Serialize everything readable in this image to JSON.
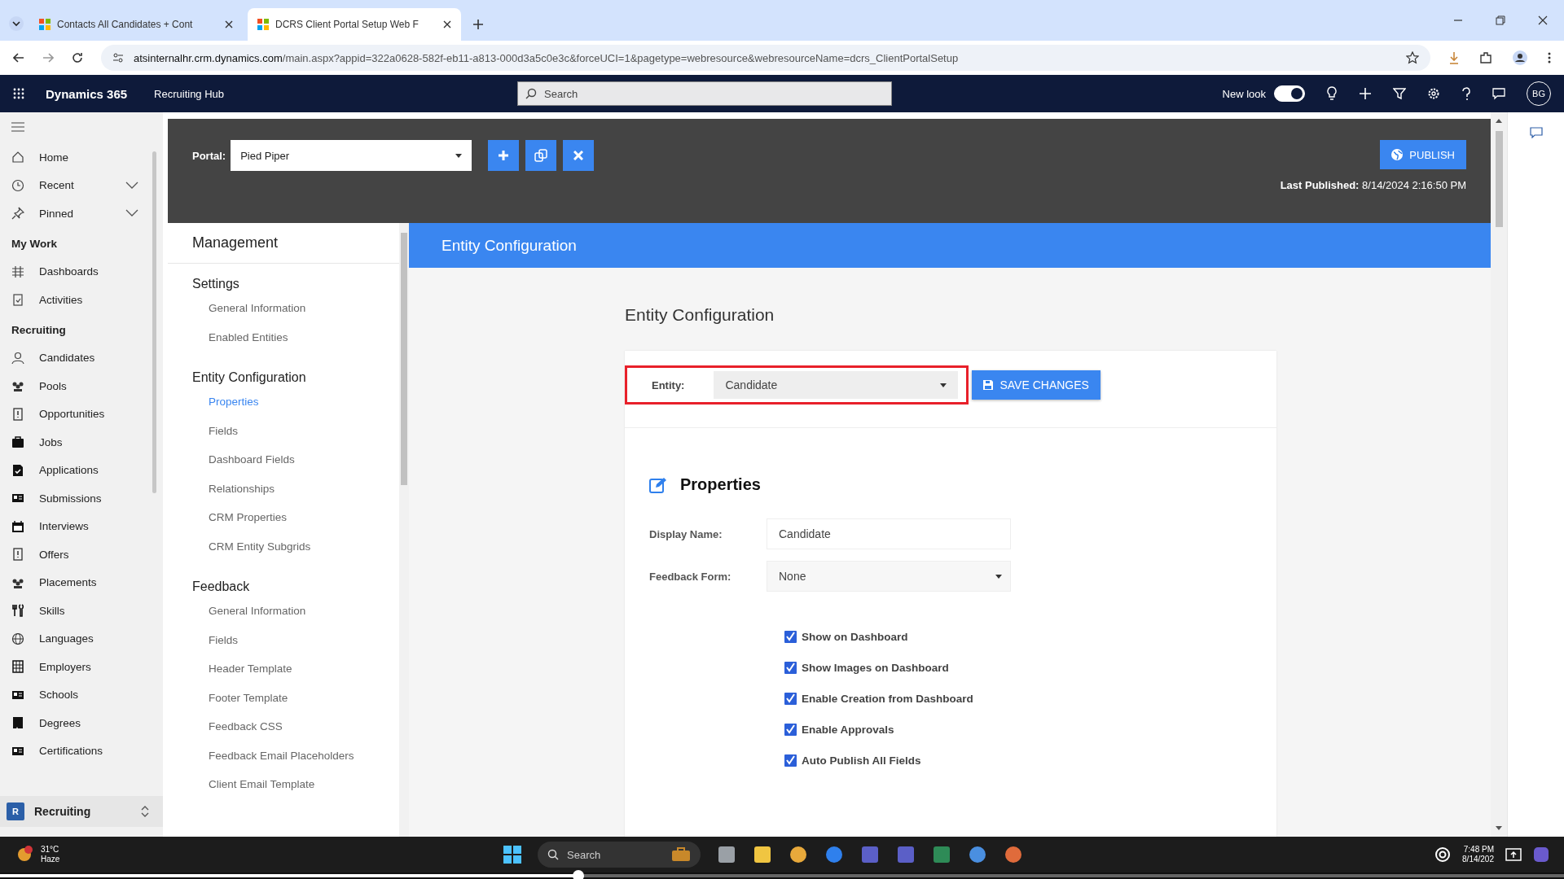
{
  "browser": {
    "tabs": [
      {
        "label": "Contacts All Candidates + Cont",
        "selected": false
      },
      {
        "label": "DCRS Client Portal Setup Web F",
        "selected": true
      }
    ],
    "url_host": "atsinternalhr.crm.dynamics.com",
    "url_path": "/main.aspx?appid=322a0628-582f-eb11-a813-000d3a5c0e3c&forceUCI=1&pagetype=webresource&webresourceName=dcrs_ClientPortalSetup"
  },
  "app": {
    "name": "Dynamics 365",
    "area": "Recruiting Hub",
    "search_placeholder": "Search",
    "new_look_label": "New look",
    "new_look_on": true,
    "avatar": "BG"
  },
  "nav": {
    "items": [
      {
        "kind": "item",
        "label": "Home",
        "expandable": false
      },
      {
        "kind": "item",
        "label": "Recent",
        "expandable": true
      },
      {
        "kind": "item",
        "label": "Pinned",
        "expandable": true
      },
      {
        "kind": "group",
        "label": "My Work"
      },
      {
        "kind": "item",
        "label": "Dashboards",
        "expandable": false
      },
      {
        "kind": "item",
        "label": "Activities",
        "expandable": false
      },
      {
        "kind": "group",
        "label": "Recruiting"
      },
      {
        "kind": "item",
        "label": "Candidates",
        "expandable": false
      },
      {
        "kind": "item",
        "label": "Pools",
        "expandable": false
      },
      {
        "kind": "item",
        "label": "Opportunities",
        "expandable": false
      },
      {
        "kind": "item",
        "label": "Jobs",
        "expandable": false
      },
      {
        "kind": "item",
        "label": "Applications",
        "expandable": false
      },
      {
        "kind": "item",
        "label": "Submissions",
        "expandable": false
      },
      {
        "kind": "item",
        "label": "Interviews",
        "expandable": false
      },
      {
        "kind": "item",
        "label": "Offers",
        "expandable": false
      },
      {
        "kind": "item",
        "label": "Placements",
        "expandable": false
      },
      {
        "kind": "item",
        "label": "Skills",
        "expandable": false
      },
      {
        "kind": "item",
        "label": "Languages",
        "expandable": false
      },
      {
        "kind": "item",
        "label": "Employers",
        "expandable": false
      },
      {
        "kind": "item",
        "label": "Schools",
        "expandable": false
      },
      {
        "kind": "item",
        "label": "Degrees",
        "expandable": false
      },
      {
        "kind": "item",
        "label": "Certifications",
        "expandable": false
      }
    ],
    "area_badge": "R",
    "area_label": "Recruiting"
  },
  "portal": {
    "label": "Portal:",
    "value": "Pied Piper",
    "publish": "PUBLISH",
    "last_published_label": "Last Published:",
    "last_published": "8/14/2024 2:16:50 PM"
  },
  "menu": {
    "title": "Management",
    "sections": [
      {
        "title": "Settings",
        "items": [
          {
            "label": "General Information",
            "selected": false
          },
          {
            "label": "Enabled Entities",
            "selected": false
          }
        ]
      },
      {
        "title": "Entity Configuration",
        "items": [
          {
            "label": "Properties",
            "selected": true
          },
          {
            "label": "Fields",
            "selected": false
          },
          {
            "label": "Dashboard Fields",
            "selected": false
          },
          {
            "label": "Relationships",
            "selected": false
          },
          {
            "label": "CRM Properties",
            "selected": false
          },
          {
            "label": "CRM Entity Subgrids",
            "selected": false
          }
        ]
      },
      {
        "title": "Feedback",
        "items": [
          {
            "label": "General Information",
            "selected": false
          },
          {
            "label": "Fields",
            "selected": false
          },
          {
            "label": "Header Template",
            "selected": false
          },
          {
            "label": "Footer Template",
            "selected": false
          },
          {
            "label": "Feedback CSS",
            "selected": false
          },
          {
            "label": "Feedback Email Placeholders",
            "selected": false
          },
          {
            "label": "Client Email Template",
            "selected": false
          }
        ]
      }
    ]
  },
  "header": "Entity Configuration",
  "page_title": "Entity Configuration",
  "entity": {
    "label": "Entity:",
    "value": "Candidate",
    "highlighted": true
  },
  "save_button": "SAVE CHANGES",
  "properties": {
    "title": "Properties",
    "fields": [
      {
        "kind": "text",
        "label": "Display Name:",
        "value": "Candidate"
      },
      {
        "kind": "select",
        "label": "Feedback Form:",
        "value": "None"
      }
    ],
    "checkboxes": [
      {
        "label": "Show on Dashboard",
        "checked": true
      },
      {
        "label": "Show Images on Dashboard",
        "checked": true
      },
      {
        "label": "Enable Creation from Dashboard",
        "checked": true
      },
      {
        "label": "Enable Approvals",
        "checked": true
      },
      {
        "label": "Auto Publish All Fields",
        "checked": true
      }
    ]
  },
  "taskbar": {
    "temperature": "31°C",
    "weather": "Haze",
    "search_placeholder": "Search",
    "time": "7:48 PM",
    "date": "8/14/202"
  },
  "video_progress": {
    "level": 0.37
  }
}
